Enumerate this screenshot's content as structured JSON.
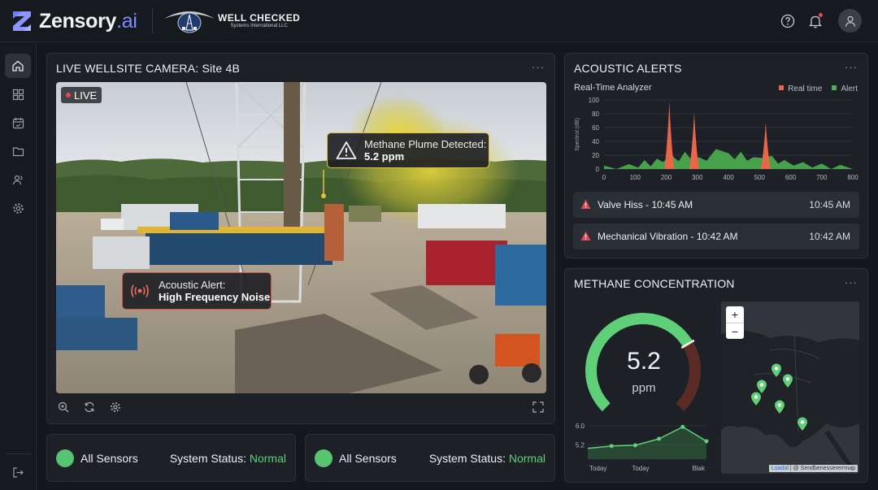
{
  "brand": {
    "name": "Zensory",
    "suffix": ".ai",
    "partner_title": "WELL CHECKED",
    "partner_sub": "Systems International LLC"
  },
  "header": {
    "icons": [
      "help-icon",
      "bell-icon",
      "user-icon"
    ]
  },
  "sidebar": {
    "items": [
      "home-icon",
      "grid-icon",
      "calendar-icon",
      "folder-icon",
      "users-icon",
      "gear-icon"
    ],
    "logout": "logout-icon"
  },
  "camera": {
    "title": "LIVE WELLSITE CAMERA: Site 4B",
    "menu": "···",
    "live_label": "LIVE",
    "methane_callout": {
      "line1": "Methane Plume Detected:",
      "line2": "5.2 ppm"
    },
    "acoustic_callout": {
      "line1": "Acoustic Alert:",
      "line2": "High Frequency Noise"
    },
    "tools": [
      "zoom-in-icon",
      "refresh-icon",
      "settings-icon",
      "fullscreen-icon"
    ]
  },
  "status_cards": [
    {
      "label": "All Sensors",
      "system_label": "System Status:",
      "status": "Normal"
    },
    {
      "label": "All Sensors",
      "system_label": "System Status:",
      "status": "Normal"
    }
  ],
  "acoustic": {
    "title": "ACOUSTIC ALERTS",
    "menu": "···",
    "analyzer_label": "Real-Time Analyzer",
    "legend": [
      {
        "name": "Real time",
        "color": "#e8674a"
      },
      {
        "name": "Alert",
        "color": "#4caf50"
      }
    ],
    "alerts": [
      {
        "title": "Valve Hiss - 10:45 AM",
        "time": "10:45 AM"
      },
      {
        "title": "Mechanical Vibration - 10:42 AM",
        "time": "10:42 AM"
      }
    ]
  },
  "methane": {
    "title": "METHANE CONCENTRATION",
    "menu": "···",
    "value": "5.2",
    "unit": "ppm",
    "gauge_fraction": 0.72,
    "map_zoom_in": "+",
    "map_zoom_out": "−",
    "attribution_link": "Loadal",
    "attribution_text": " | @ Sendbenessererrmap"
  },
  "chart_data": [
    {
      "type": "area",
      "ylabel": "Spectrol (dB)",
      "xlim": [
        0,
        800
      ],
      "ylim": [
        0,
        100
      ],
      "x_ticks": [
        0,
        100,
        200,
        300,
        400,
        500,
        600,
        700,
        800
      ],
      "y_ticks": [
        0,
        20,
        40,
        60,
        80,
        100
      ],
      "series": [
        {
          "name": "Alert",
          "color": "#4caf50",
          "x": [
            0,
            40,
            80,
            110,
            130,
            150,
            170,
            190,
            215,
            240,
            260,
            280,
            305,
            330,
            360,
            380,
            400,
            420,
            440,
            460,
            480,
            510,
            540,
            560,
            580,
            610,
            640,
            670,
            700,
            730,
            760,
            800
          ],
          "values": [
            2,
            3,
            4,
            6,
            10,
            8,
            12,
            14,
            18,
            15,
            22,
            18,
            14,
            16,
            26,
            30,
            20,
            18,
            22,
            16,
            14,
            20,
            16,
            12,
            10,
            9,
            7,
            6,
            5,
            4,
            3,
            2
          ]
        },
        {
          "name": "Real time",
          "color": "#e8674a",
          "peaks": [
            {
              "x": 210,
              "y": 98
            },
            {
              "x": 290,
              "y": 82
            },
            {
              "x": 520,
              "y": 68
            }
          ]
        }
      ]
    },
    {
      "type": "line",
      "categories": [
        "Today",
        "Today",
        "Blak"
      ],
      "y_ticks": [
        5.2,
        6.0
      ],
      "ylim": [
        4.6,
        6.3
      ],
      "x": [
        0,
        1,
        2,
        3,
        4,
        5
      ],
      "values": [
        5.05,
        5.15,
        5.18,
        5.45,
        5.95,
        5.35
      ]
    }
  ]
}
